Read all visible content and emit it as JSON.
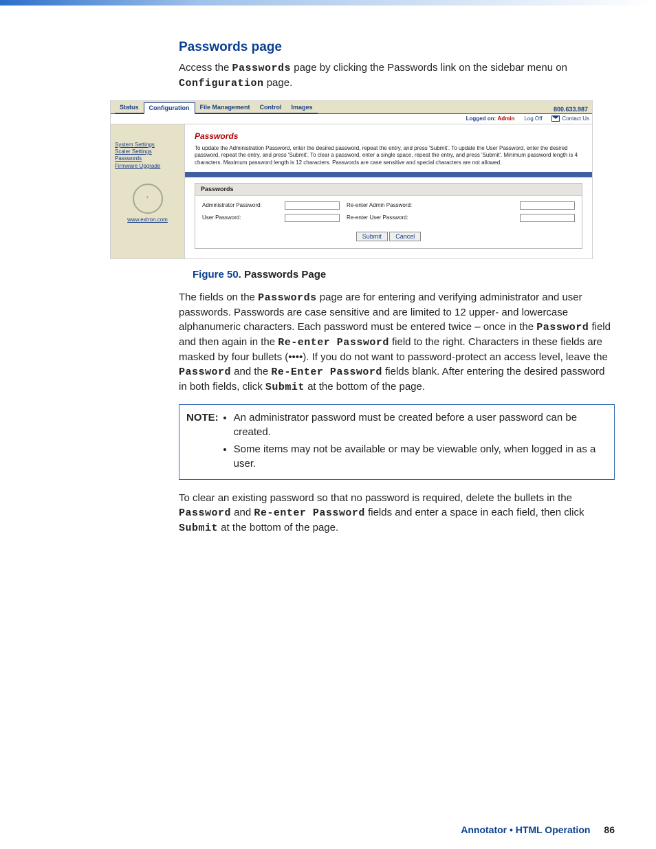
{
  "heading": "Passwords page",
  "intro": {
    "t1": "Access the ",
    "t2": "Passwords",
    "t3": " page by clicking the Passwords link on the sidebar menu on ",
    "t4": "Configuration",
    "t5": " page."
  },
  "shot": {
    "tabs": [
      "Status",
      "Configuration",
      "File Management",
      "Control",
      "Images"
    ],
    "phone": "800.633.987",
    "logged_label": "Logged on:",
    "logged_user": "Admin",
    "logoff": "Log Off",
    "contact": "Contact Us",
    "side": [
      "System Settings",
      "Scaler Settings",
      "Passwords",
      "Firmware Upgrade"
    ],
    "logo_url": "www.extron.com",
    "title": "Passwords",
    "instr": "To update the Administration Password, enter the desired password, repeat the entry, and press 'Submit'.  To update the User Password, enter the desired password, repeat the entry, and press 'Submit'.  To clear a password, enter a single space, repeat the entry, and press 'Submit'.  Minimum password length is 4 characters.  Maximum password length is 12 characters.  Passwords are case sensitive and special characters are not allowed.",
    "box_header": "Passwords",
    "labels": {
      "admin": "Administrator Password:",
      "admin2": "Re-enter Admin Password:",
      "user": "User Password:",
      "user2": "Re-enter User Password:"
    },
    "submit": "Submit",
    "cancel": "Cancel"
  },
  "fig": {
    "num": "Figure 50.",
    "title": "Passwords Page"
  },
  "para2": {
    "t1": "The fields on the ",
    "t2": "Passwords",
    "t3": " page are for entering and verifying administrator and user passwords. Passwords are case sensitive and are limited to 12 upper- and lowercase alphanumeric characters. Each password must be entered twice – once in the ",
    "t4": "Password",
    "t5": " field and then again in the ",
    "t6": "Re-enter Password",
    "t7": " field to the right. Characters in these fields are masked by four bullets (••••). If you do not want to password-protect an access level, leave the ",
    "t8": "Password",
    "t9": " and the ",
    "t10": "Re-Enter Password",
    "t11": " fields blank. After entering the desired password in both fields, click ",
    "t12": "Submit",
    "t13": " at the bottom of the page."
  },
  "note": {
    "label": "NOTE:",
    "items": [
      "An administrator password must be created before a user password can be created.",
      "Some items may not be available or may be viewable only, when logged in as a user."
    ]
  },
  "para3": {
    "t1": "To clear an existing password so that no password is required, delete the bullets in the ",
    "t2": "Password",
    "t3": " and ",
    "t4": "Re-enter Password",
    "t5": " fields and enter a space in each field, then click ",
    "t6": "Submit",
    "t7": " at the bottom of the page."
  },
  "footer": {
    "text": "Annotator • HTML Operation",
    "page": "86"
  }
}
